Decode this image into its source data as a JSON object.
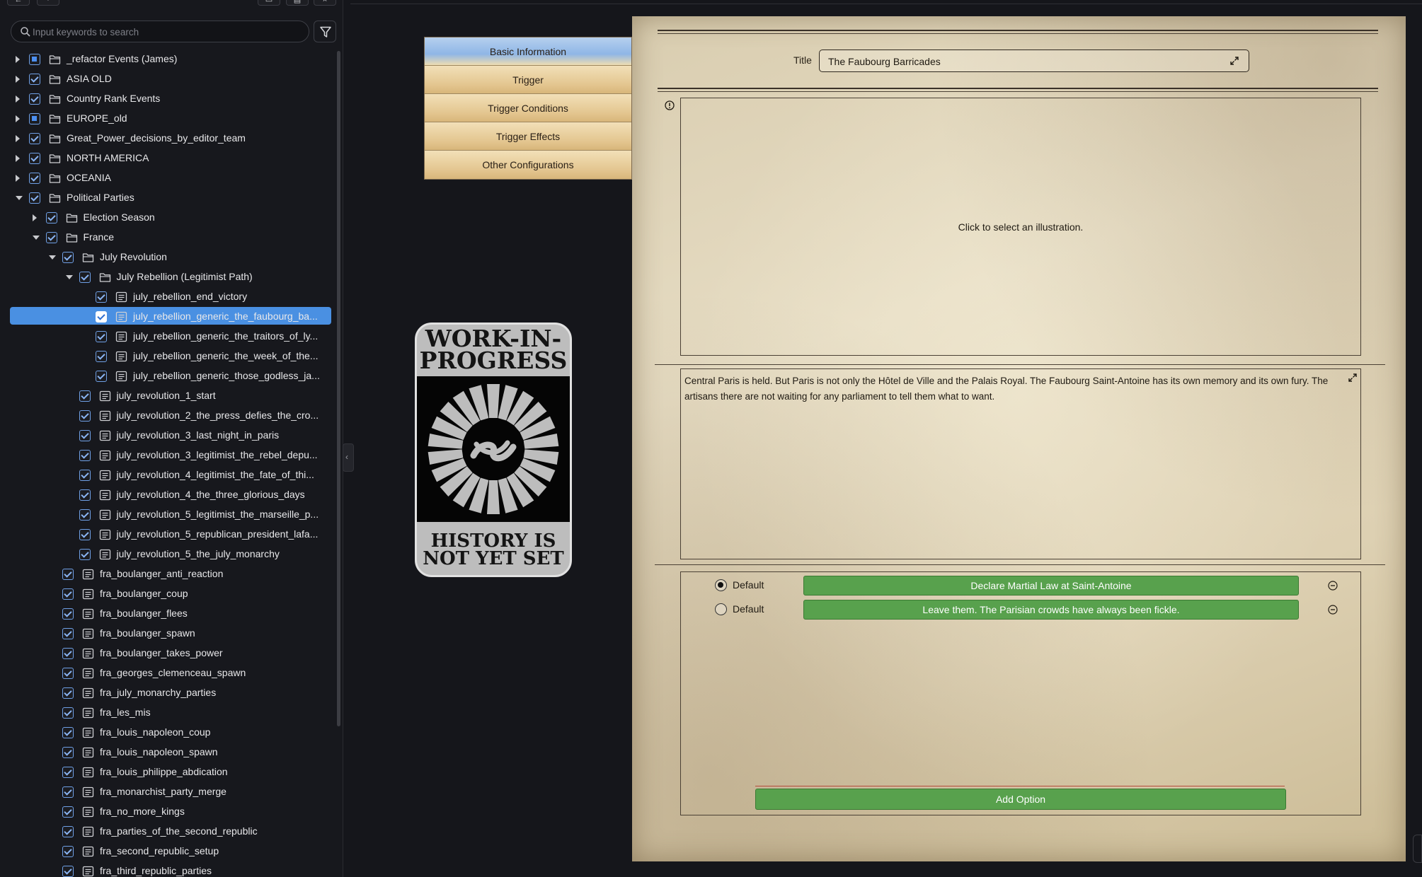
{
  "sidebar": {
    "toolbar": {
      "icons": [
        "collapse-left-icon",
        "layout-icon",
        "save-icon",
        "box-icon",
        "close-icon"
      ],
      "glyphs": [
        "←",
        "·",
        "▭",
        "▤",
        "×"
      ]
    },
    "search": {
      "placeholder": "Input keywords to search",
      "value": ""
    },
    "tree": [
      {
        "label": "_refactor Events (James)",
        "type": "folder",
        "depth": 0,
        "expanded": false,
        "check": "partial"
      },
      {
        "label": "ASIA OLD",
        "type": "folder",
        "depth": 0,
        "expanded": false,
        "check": "checked"
      },
      {
        "label": "Country Rank Events",
        "type": "folder",
        "depth": 0,
        "expanded": false,
        "check": "checked"
      },
      {
        "label": "EUROPE_old",
        "type": "folder",
        "depth": 0,
        "expanded": false,
        "check": "partial"
      },
      {
        "label": "Great_Power_decisions_by_editor_team",
        "type": "folder",
        "depth": 0,
        "expanded": false,
        "check": "checked"
      },
      {
        "label": "NORTH AMERICA",
        "type": "folder",
        "depth": 0,
        "expanded": false,
        "check": "checked"
      },
      {
        "label": "OCEANIA",
        "type": "folder",
        "depth": 0,
        "expanded": false,
        "check": "checked"
      },
      {
        "label": "Political Parties",
        "type": "folder",
        "depth": 0,
        "expanded": true,
        "check": "checked"
      },
      {
        "label": "Election Season",
        "type": "folder",
        "depth": 1,
        "expanded": false,
        "check": "checked"
      },
      {
        "label": "France",
        "type": "folder",
        "depth": 1,
        "expanded": true,
        "check": "checked"
      },
      {
        "label": "July Revolution",
        "type": "folder",
        "depth": 2,
        "expanded": true,
        "check": "checked"
      },
      {
        "label": "July Rebellion (Legitimist Path)",
        "type": "folder",
        "depth": 3,
        "expanded": true,
        "check": "checked"
      },
      {
        "label": "july_rebellion_end_victory",
        "type": "file",
        "depth": 4,
        "check": "checked"
      },
      {
        "label": "july_rebellion_generic_the_faubourg_ba...",
        "type": "file",
        "depth": 4,
        "check": "checked",
        "selected": true
      },
      {
        "label": "july_rebellion_generic_the_traitors_of_ly...",
        "type": "file",
        "depth": 4,
        "check": "checked"
      },
      {
        "label": "july_rebellion_generic_the_week_of_the...",
        "type": "file",
        "depth": 4,
        "check": "checked"
      },
      {
        "label": "july_rebellion_generic_those_godless_ja...",
        "type": "file",
        "depth": 4,
        "check": "checked"
      },
      {
        "label": "july_revolution_1_start",
        "type": "file",
        "depth": 3,
        "check": "checked"
      },
      {
        "label": "july_revolution_2_the_press_defies_the_cro...",
        "type": "file",
        "depth": 3,
        "check": "checked"
      },
      {
        "label": "july_revolution_3_last_night_in_paris",
        "type": "file",
        "depth": 3,
        "check": "checked"
      },
      {
        "label": "july_revolution_3_legitimist_the_rebel_depu...",
        "type": "file",
        "depth": 3,
        "check": "checked"
      },
      {
        "label": "july_revolution_4_legitimist_the_fate_of_thi...",
        "type": "file",
        "depth": 3,
        "check": "checked"
      },
      {
        "label": "july_revolution_4_the_three_glorious_days",
        "type": "file",
        "depth": 3,
        "check": "checked"
      },
      {
        "label": "july_revolution_5_legitimist_the_marseille_p...",
        "type": "file",
        "depth": 3,
        "check": "checked"
      },
      {
        "label": "july_revolution_5_republican_president_lafa...",
        "type": "file",
        "depth": 3,
        "check": "checked"
      },
      {
        "label": "july_revolution_5_the_july_monarchy",
        "type": "file",
        "depth": 3,
        "check": "checked"
      },
      {
        "label": "fra_boulanger_anti_reaction",
        "type": "file",
        "depth": 2,
        "check": "checked"
      },
      {
        "label": "fra_boulanger_coup",
        "type": "file",
        "depth": 2,
        "check": "checked"
      },
      {
        "label": "fra_boulanger_flees",
        "type": "file",
        "depth": 2,
        "check": "checked"
      },
      {
        "label": "fra_boulanger_spawn",
        "type": "file",
        "depth": 2,
        "check": "checked"
      },
      {
        "label": "fra_boulanger_takes_power",
        "type": "file",
        "depth": 2,
        "check": "checked"
      },
      {
        "label": "fra_georges_clemenceau_spawn",
        "type": "file",
        "depth": 2,
        "check": "checked"
      },
      {
        "label": "fra_july_monarchy_parties",
        "type": "file",
        "depth": 2,
        "check": "checked"
      },
      {
        "label": "fra_les_mis",
        "type": "file",
        "depth": 2,
        "check": "checked"
      },
      {
        "label": "fra_louis_napoleon_coup",
        "type": "file",
        "depth": 2,
        "check": "checked"
      },
      {
        "label": "fra_louis_napoleon_spawn",
        "type": "file",
        "depth": 2,
        "check": "checked"
      },
      {
        "label": "fra_louis_philippe_abdication",
        "type": "file",
        "depth": 2,
        "check": "checked"
      },
      {
        "label": "fra_monarchist_party_merge",
        "type": "file",
        "depth": 2,
        "check": "checked"
      },
      {
        "label": "fra_no_more_kings",
        "type": "file",
        "depth": 2,
        "check": "checked"
      },
      {
        "label": "fra_parties_of_the_second_republic",
        "type": "file",
        "depth": 2,
        "check": "checked"
      },
      {
        "label": "fra_second_republic_setup",
        "type": "file",
        "depth": 2,
        "check": "checked"
      },
      {
        "label": "fra_third_republic_parties",
        "type": "file",
        "depth": 2,
        "check": "checked"
      }
    ],
    "collapse_glyph": "‹"
  },
  "tabs": [
    {
      "label": "Basic Information",
      "active": true
    },
    {
      "label": "Trigger",
      "active": false
    },
    {
      "label": "Trigger Conditions",
      "active": false
    },
    {
      "label": "Trigger Effects",
      "active": false
    },
    {
      "label": "Other Configurations",
      "active": false
    }
  ],
  "wip_badge": {
    "line1": "WORK-IN-",
    "line2": "PROGRESS",
    "line3": "HISTORY IS",
    "line4": "NOT YET SET"
  },
  "editor": {
    "title_label": "Title",
    "title_value": "The Faubourg Barricades",
    "illustration_prompt": "Click to select an illustration.",
    "description": "Central Paris is held. But Paris is not only the Hôtel de Ville and the Palais Royal. The Faubourg Saint-Antoine has its own memory and its own fury. The artisans there are not waiting for any parliament to tell them what to want.",
    "options": [
      {
        "default_label": "Default",
        "selected": true,
        "text": "Declare Martial Law at Saint-Antoine"
      },
      {
        "default_label": "Default",
        "selected": false,
        "text": "Leave them. The Parisian crowds have always been fickle."
      }
    ],
    "add_option_label": "Add Option"
  },
  "colors": {
    "selection": "#4a90e2",
    "checkbox": "#6fa0e6",
    "option_green": "#58a14d",
    "tab_active": "#8fb6e6",
    "tab_inactive": "#e3c58f",
    "parchment": "#e0d5ba"
  }
}
